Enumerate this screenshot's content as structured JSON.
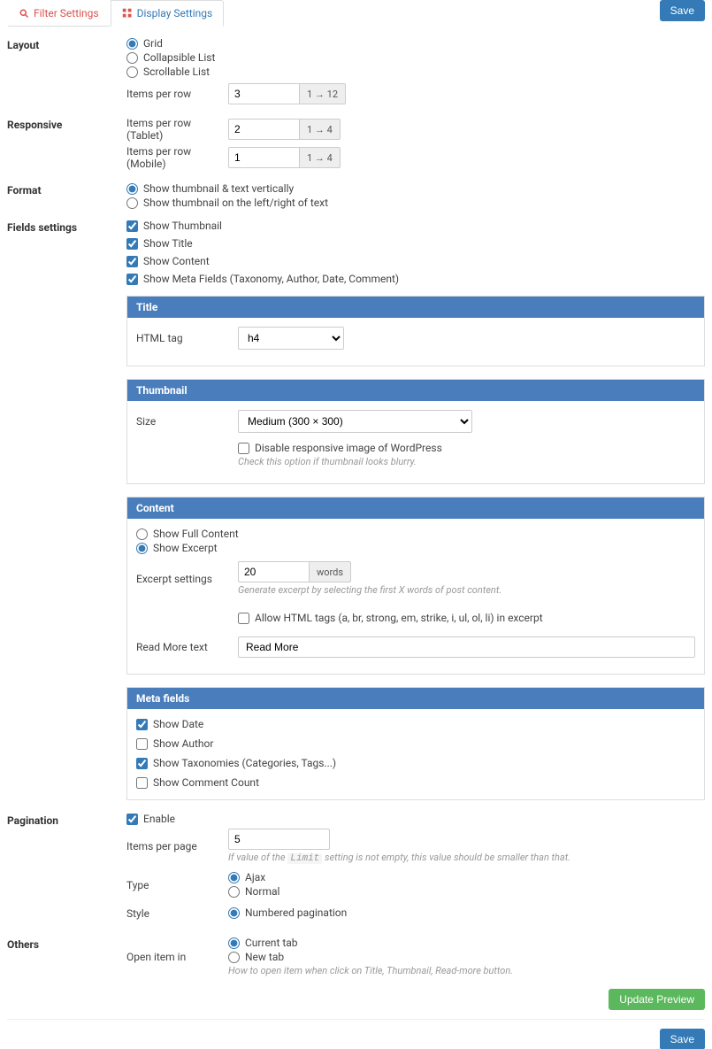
{
  "tabs": {
    "filter": "Filter Settings",
    "display": "Display Settings"
  },
  "buttons": {
    "save": "Save",
    "update_preview": "Update Preview"
  },
  "layout": {
    "label": "Layout",
    "options": {
      "grid": "Grid",
      "collapsible": "Collapsible List",
      "scrollable": "Scrollable List"
    },
    "items_per_row_label": "Items per row",
    "items_per_row_value": "3",
    "items_per_row_range": "1 → 12"
  },
  "responsive": {
    "label": "Responsive",
    "tablet_label": "Items per row (Tablet)",
    "tablet_value": "2",
    "tablet_range": "1 → 4",
    "mobile_label": "Items per row (Mobile)",
    "mobile_value": "1",
    "mobile_range": "1 → 4"
  },
  "format": {
    "label": "Format",
    "vertical": "Show thumbnail & text vertically",
    "side": "Show thumbnail on the left/right of text"
  },
  "fields": {
    "label": "Fields settings",
    "thumbnail": "Show Thumbnail",
    "title": "Show Title",
    "content": "Show Content",
    "meta": "Show Meta Fields (Taxonomy, Author, Date, Comment)"
  },
  "title_panel": {
    "header": "Title",
    "html_tag_label": "HTML tag",
    "html_tag_value": "h4"
  },
  "thumbnail_panel": {
    "header": "Thumbnail",
    "size_label": "Size",
    "size_value": "Medium (300 × 300)",
    "disable_responsive": "Disable responsive image of WordPress",
    "hint": "Check this option if thumbnail looks blurry."
  },
  "content_panel": {
    "header": "Content",
    "full": "Show Full Content",
    "excerpt": "Show Excerpt",
    "excerpt_settings_label": "Excerpt settings",
    "excerpt_value": "20",
    "excerpt_suffix": "words",
    "excerpt_hint": "Generate excerpt by selecting the first X words of post content.",
    "allow_html": "Allow HTML tags (a, br, strong, em, strike, i, ul, ol, li) in excerpt",
    "readmore_label": "Read More text",
    "readmore_value": "Read More"
  },
  "meta_panel": {
    "header": "Meta fields",
    "date": "Show Date",
    "author": "Show Author",
    "taxonomies": "Show Taxonomies (Categories, Tags...)",
    "comment": "Show Comment Count"
  },
  "pagination": {
    "label": "Pagination",
    "enable": "Enable",
    "items_per_page_label": "Items per page",
    "items_per_page_value": "5",
    "hint_pre": "If value of the ",
    "hint_code": "Limit",
    "hint_post": " setting is not empty, this value should be smaller than that.",
    "type_label": "Type",
    "ajax": "Ajax",
    "normal": "Normal",
    "style_label": "Style",
    "numbered": "Numbered pagination"
  },
  "others": {
    "label": "Others",
    "open_label": "Open item in",
    "current": "Current tab",
    "newtab": "New tab",
    "hint": "How to open item when click on Title, Thumbnail, Read-more button."
  }
}
